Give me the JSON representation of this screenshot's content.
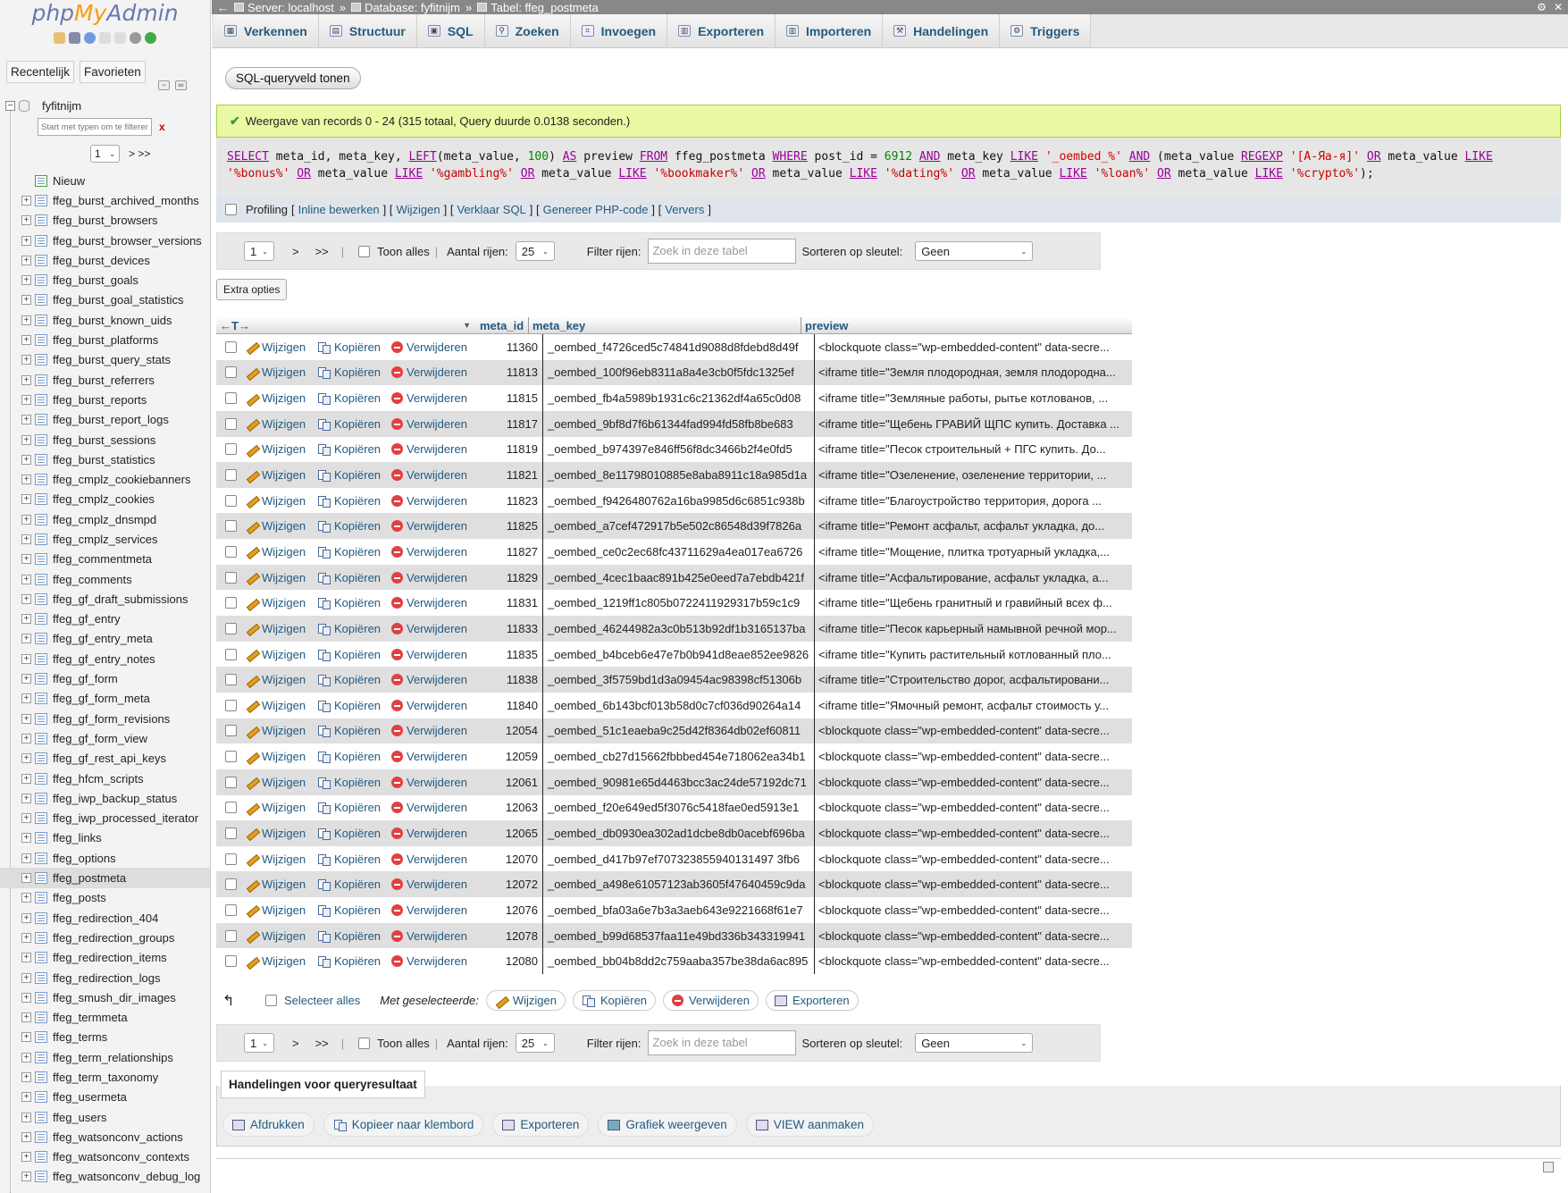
{
  "logo": {
    "php": "php",
    "my": "My",
    "admin": "Admin"
  },
  "sidebar": {
    "tabs": [
      "Recentelijk",
      "Favorieten"
    ],
    "database": "fyfitnijm",
    "filter_placeholder": "Start met typen om te filteren,",
    "filter_clear": "x",
    "page_select": "1",
    "page_next": "> >>",
    "new_label": "Nieuw",
    "tables": [
      "ffeg_burst_archived_months",
      "ffeg_burst_browsers",
      "ffeg_burst_browser_versions",
      "ffeg_burst_devices",
      "ffeg_burst_goals",
      "ffeg_burst_goal_statistics",
      "ffeg_burst_known_uids",
      "ffeg_burst_platforms",
      "ffeg_burst_query_stats",
      "ffeg_burst_referrers",
      "ffeg_burst_reports",
      "ffeg_burst_report_logs",
      "ffeg_burst_sessions",
      "ffeg_burst_statistics",
      "ffeg_cmplz_cookiebanners",
      "ffeg_cmplz_cookies",
      "ffeg_cmplz_dnsmpd",
      "ffeg_cmplz_services",
      "ffeg_commentmeta",
      "ffeg_comments",
      "ffeg_gf_draft_submissions",
      "ffeg_gf_entry",
      "ffeg_gf_entry_meta",
      "ffeg_gf_entry_notes",
      "ffeg_gf_form",
      "ffeg_gf_form_meta",
      "ffeg_gf_form_revisions",
      "ffeg_gf_form_view",
      "ffeg_gf_rest_api_keys",
      "ffeg_hfcm_scripts",
      "ffeg_iwp_backup_status",
      "ffeg_iwp_processed_iterator",
      "ffeg_links",
      "ffeg_options",
      "ffeg_postmeta",
      "ffeg_posts",
      "ffeg_redirection_404",
      "ffeg_redirection_groups",
      "ffeg_redirection_items",
      "ffeg_redirection_logs",
      "ffeg_smush_dir_images",
      "ffeg_termmeta",
      "ffeg_terms",
      "ffeg_term_relationships",
      "ffeg_term_taxonomy",
      "ffeg_usermeta",
      "ffeg_users",
      "ffeg_watsonconv_actions",
      "ffeg_watsonconv_contexts",
      "ffeg_watsonconv_debug_log"
    ],
    "active_table": "ffeg_postmeta"
  },
  "breadcrumb": {
    "server": "Server: localhost",
    "database": "Database: fyfitnijm",
    "table": "Tabel: ffeg_postmeta",
    "sep": "»"
  },
  "tabs": [
    "Verkennen",
    "Structuur",
    "SQL",
    "Zoeken",
    "Invoegen",
    "Exporteren",
    "Importeren",
    "Handelingen",
    "Triggers"
  ],
  "sql_toggle": "SQL-queryveld tonen",
  "success_msg": "Weergave van records 0 - 24 (315 totaal, Query duurde 0.0138 seconden.)",
  "sql": {
    "line1": [
      [
        "kw",
        "SELECT"
      ],
      [
        "op",
        " meta_id, meta_key, "
      ],
      [
        "kw",
        "LEFT"
      ],
      [
        "op",
        "(meta_value, "
      ],
      [
        "num",
        "100"
      ],
      [
        "op",
        ") "
      ],
      [
        "kw",
        "AS"
      ],
      [
        "op",
        " preview "
      ],
      [
        "kw",
        "FROM"
      ],
      [
        "op",
        " ffeg_postmeta "
      ],
      [
        "kw",
        "WHERE"
      ],
      [
        "op",
        " post_id = "
      ],
      [
        "num",
        "6912"
      ],
      [
        "op",
        " "
      ],
      [
        "kw",
        "AND"
      ],
      [
        "op",
        " meta_key "
      ],
      [
        "kw",
        "LIKE"
      ],
      [
        "op",
        " "
      ],
      [
        "str",
        "'_oembed_%'"
      ],
      [
        "op",
        " "
      ],
      [
        "kw",
        "AND"
      ],
      [
        "op",
        " (meta_value "
      ],
      [
        "kw",
        "REGEXP"
      ],
      [
        "op",
        " "
      ],
      [
        "str",
        "'[А-Яа-я]'"
      ],
      [
        "op",
        " "
      ],
      [
        "kw",
        "OR"
      ],
      [
        "op",
        " meta_value "
      ],
      [
        "kw",
        "LIKE"
      ]
    ],
    "line2": [
      [
        "str",
        "'%bonus%'"
      ],
      [
        "op",
        " "
      ],
      [
        "kw",
        "OR"
      ],
      [
        "op",
        " meta_value "
      ],
      [
        "kw",
        "LIKE"
      ],
      [
        "op",
        " "
      ],
      [
        "str",
        "'%gambling%'"
      ],
      [
        "op",
        " "
      ],
      [
        "kw",
        "OR"
      ],
      [
        "op",
        " meta_value "
      ],
      [
        "kw",
        "LIKE"
      ],
      [
        "op",
        " "
      ],
      [
        "str",
        "'%bookmaker%'"
      ],
      [
        "op",
        " "
      ],
      [
        "kw",
        "OR"
      ],
      [
        "op",
        " meta_value "
      ],
      [
        "kw",
        "LIKE"
      ],
      [
        "op",
        " "
      ],
      [
        "str",
        "'%dating%'"
      ],
      [
        "op",
        " "
      ],
      [
        "kw",
        "OR"
      ],
      [
        "op",
        " meta_value "
      ],
      [
        "kw",
        "LIKE"
      ],
      [
        "op",
        " "
      ],
      [
        "str",
        "'%loan%'"
      ],
      [
        "op",
        " "
      ],
      [
        "kw",
        "OR"
      ],
      [
        "op",
        " meta_value "
      ],
      [
        "kw",
        "LIKE"
      ],
      [
        "op",
        " "
      ],
      [
        "str",
        "'%crypto%'"
      ],
      [
        "op",
        ");"
      ]
    ]
  },
  "profiling": {
    "label": "Profiling",
    "links": [
      "Inline bewerken",
      "Wijzigen",
      "Verklaar SQL",
      "Genereer PHP-code",
      "Ververs"
    ]
  },
  "nav": {
    "page": "1",
    "next": ">",
    "last": ">>",
    "show_all": "Toon alles",
    "rows_label": "Aantal rijen:",
    "rows_value": "25",
    "filter_label": "Filter rijen:",
    "filter_placeholder": "Zoek in deze tabel",
    "sort_label": "Sorteren op sleutel:",
    "sort_value": "Geen"
  },
  "extra_options": "Extra opties",
  "columns": {
    "arrows": "←T→",
    "meta_id": "meta_id",
    "meta_key": "meta_key",
    "preview": "preview"
  },
  "row_actions": {
    "edit": "Wijzigen",
    "copy": "Kopiëren",
    "delete": "Verwijderen"
  },
  "rows": [
    [
      "11360",
      "_oembed_f4726ced5c74841d9088d8fdebd8d49f",
      "<blockquote class=\"wp-embedded-content\" data-secre..."
    ],
    [
      "11813",
      "_oembed_100f96eb8311a8a4e3cb0f5fdc1325ef",
      "<iframe title=\"Земля плодородная, земля плодородна..."
    ],
    [
      "11815",
      "_oembed_fb4a5989b1931c6c21362df4a65c0d08",
      "<iframe title=\"Земляные работы, рытье котлованов, ..."
    ],
    [
      "11817",
      "_oembed_9bf8d7f6b61344fad994fd58fb8be683",
      "<iframe title=\"Щебень ГРАВИЙ ЩПС купить. Доставка ..."
    ],
    [
      "11819",
      "_oembed_b974397e846ff56f8dc3466b2f4e0fd5",
      "<iframe title=\"Песок строительный + ПГС купить. До..."
    ],
    [
      "11821",
      "_oembed_8e11798010885e8aba8911c18a985d1a",
      "<iframe title=\"Озеленение, озеленение территории, ..."
    ],
    [
      "11823",
      "_oembed_f9426480762a16ba9985d6c6851c938b",
      "<iframe title=\"Благоустройство территория, дорога ..."
    ],
    [
      "11825",
      "_oembed_a7cef472917b5e502c86548d39f7826a",
      "<iframe title=\"Ремонт асфальт, асфальт укладка, до..."
    ],
    [
      "11827",
      "_oembed_ce0c2ec68fc43711629a4ea017ea6726",
      "<iframe title=\"Мощение, плитка тротуарный укладка,..."
    ],
    [
      "11829",
      "_oembed_4cec1baac891b425e0eed7a7ebdb421f",
      "<iframe title=\"Асфальтирование, асфальт укладка, а..."
    ],
    [
      "11831",
      "_oembed_1219ff1c805b0722411929317b59c1c9",
      "<iframe title=\"Щебень гранитный и гравийный всех ф..."
    ],
    [
      "11833",
      "_oembed_46244982a3c0b513b92df1b3165137ba",
      "<iframe title=\"Песок карьерный намывной речной мор..."
    ],
    [
      "11835",
      "_oembed_b4bceb6e47e7b0b941d8eae852ee9826",
      "<iframe title=\"Купить растительный котлованный пло..."
    ],
    [
      "11838",
      "_oembed_3f5759bd1d3a09454ac98398cf51306b",
      "<iframe title=\"Строительство дорог, асфальтировани..."
    ],
    [
      "11840",
      "_oembed_6b143bcf013b58d0c7cf036d90264a14",
      "<iframe title=\"Ямочный ремонт, асфальт стоимость у..."
    ],
    [
      "12054",
      "_oembed_51c1eaeba9c25d42f8364db02ef60811",
      "<blockquote class=\"wp-embedded-content\" data-secre..."
    ],
    [
      "12059",
      "_oembed_cb27d15662fbbbed454e718062ea34b1",
      "<blockquote class=\"wp-embedded-content\" data-secre..."
    ],
    [
      "12061",
      "_oembed_90981e65d4463bcc3ac24de57192dc71",
      "<blockquote class=\"wp-embedded-content\" data-secre..."
    ],
    [
      "12063",
      "_oembed_f20e649ed5f3076c5418fae0ed5913e1",
      "<blockquote class=\"wp-embedded-content\" data-secre..."
    ],
    [
      "12065",
      "_oembed_db0930ea302ad1dcbe8db0acebf696ba",
      "<blockquote class=\"wp-embedded-content\" data-secre..."
    ],
    [
      "12070",
      "_oembed_d417b97ef707323855940131497 3fb6",
      "<blockquote class=\"wp-embedded-content\" data-secre..."
    ],
    [
      "12072",
      "_oembed_a498e61057123ab3605f47640459c9da",
      "<blockquote class=\"wp-embedded-content\" data-secre..."
    ],
    [
      "12076",
      "_oembed_bfa03a6e7b3a3aeb643e9221668f61e7",
      "<blockquote class=\"wp-embedded-content\" data-secre..."
    ],
    [
      "12078",
      "_oembed_b99d68537faa11e49bd336b343319941",
      "<blockquote class=\"wp-embedded-content\" data-secre..."
    ],
    [
      "12080",
      "_oembed_bb04b8dd2c759aaba357be38da6ac895",
      "<blockquote class=\"wp-embedded-content\" data-secre..."
    ]
  ],
  "bulk": {
    "select_all": "Selecteer alles",
    "with_selected": "Met geselecteerde:",
    "edit": "Wijzigen",
    "copy": "Kopiëren",
    "delete": "Verwijderen",
    "export": "Exporteren"
  },
  "query_ops": {
    "title": "Handelingen voor queryresultaat",
    "buttons": [
      "Afdrukken",
      "Kopieer naar klembord",
      "Exporteren",
      "Grafiek weergeven",
      "VIEW aanmaken"
    ]
  }
}
